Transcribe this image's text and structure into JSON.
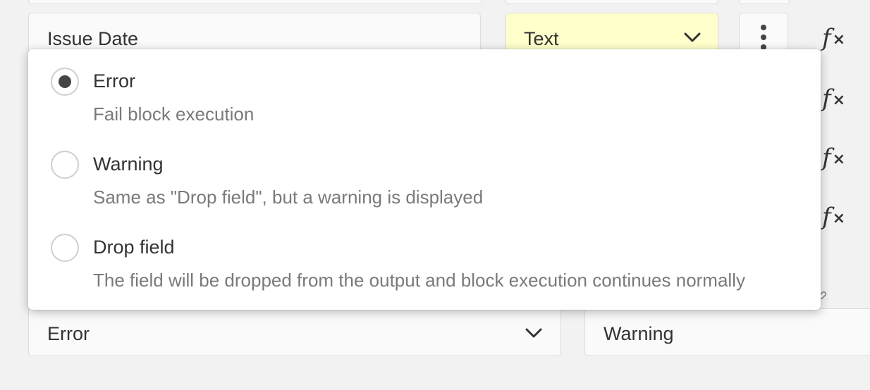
{
  "field_row": {
    "field_name": "Issue Date",
    "type_label": "Text",
    "type_bg_color": "#ffffcc"
  },
  "side_icons": [
    "function-icon",
    "function-icon",
    "function-icon",
    "function-icon"
  ],
  "popover": {
    "options": [
      {
        "title": "Error",
        "description": "Fail block execution",
        "checked": true
      },
      {
        "title": "Warning",
        "description": "Same as \"Drop field\", but a warning is displayed",
        "checked": false
      },
      {
        "title": "Drop field",
        "description": "The field will be dropped from the output and block execution continues normally",
        "checked": false
      }
    ]
  },
  "bottom_row": {
    "error_select_value": "Error",
    "warning_value": "Warning"
  }
}
